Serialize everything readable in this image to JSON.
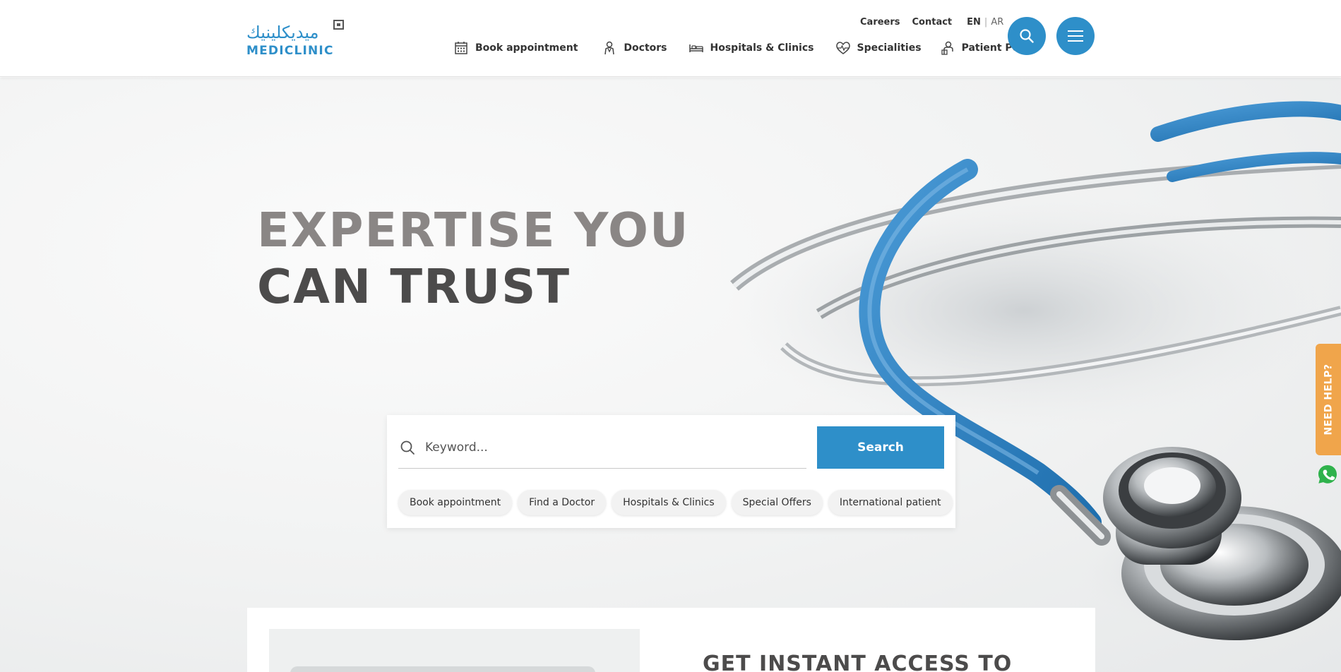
{
  "brand": {
    "name_ar": "ميديكلينيك",
    "name_en": "MEDICLINIC",
    "color": "#2e8fc9"
  },
  "top_links": {
    "careers": "Careers",
    "contact": "Contact",
    "lang_en": "EN",
    "lang_separator": "|",
    "lang_ar": "AR"
  },
  "nav": {
    "items": [
      {
        "label": "Book appointment",
        "icon": "calendar-icon"
      },
      {
        "label": "Doctors",
        "icon": "doctor-icon"
      },
      {
        "label": "Hospitals & Clinics",
        "icon": "bed-icon"
      },
      {
        "label": "Specialities",
        "icon": "heart-pulse-icon"
      },
      {
        "label": "Patient Portal",
        "icon": "patient-portal-icon"
      }
    ]
  },
  "header_buttons": {
    "search_icon": "search-icon",
    "menu_icon": "hamburger-menu-icon"
  },
  "hero": {
    "headline_line1": "EXPERTISE YOU",
    "headline_line2": "CAN TRUST"
  },
  "search": {
    "placeholder": "Keyword...",
    "value": "",
    "button_label": "Search",
    "quick_links": [
      "Book appointment",
      "Find a Doctor",
      "Hospitals & Clinics",
      "Special Offers",
      "International patient"
    ]
  },
  "side_widgets": {
    "need_help": "NEED HELP?",
    "whatsapp_icon": "whatsapp-icon",
    "need_help_color": "#f0a54b"
  },
  "access_section": {
    "title": "GET INSTANT ACCESS TO"
  }
}
